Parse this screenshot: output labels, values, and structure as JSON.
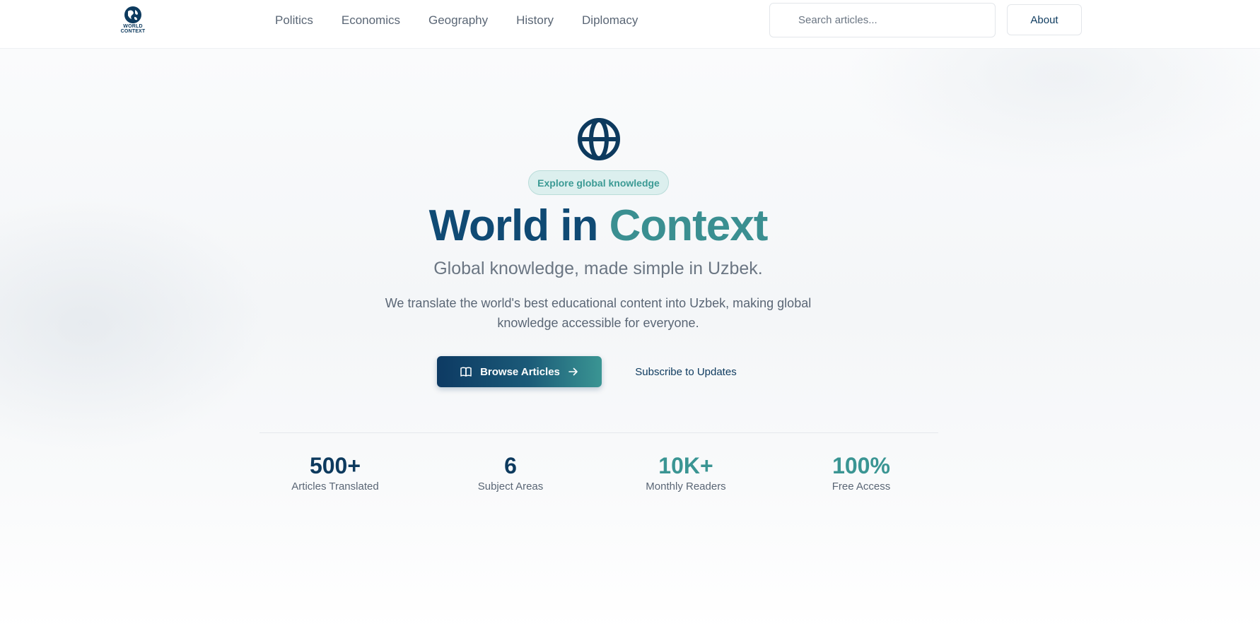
{
  "header": {
    "logo_text_line1": "WORLD",
    "logo_text_line2": "CONTEXT",
    "nav": [
      "Politics",
      "Economics",
      "Geography",
      "History",
      "Diplomacy"
    ],
    "search_placeholder": "Search articles...",
    "about_label": "About"
  },
  "hero": {
    "badge": "Explore global knowledge",
    "title_part1": "World in",
    "title_part2": "Context",
    "subtitle": "Global knowledge, made simple in Uzbek.",
    "description": "We translate the world's best educational content into Uzbek, making global knowledge accessible for everyone.",
    "browse_label": "Browse Articles",
    "subscribe_label": "Subscribe to Updates"
  },
  "stats": [
    {
      "value": "500+",
      "label": "Articles Translated",
      "color": "#0d3a5e"
    },
    {
      "value": "6",
      "label": "Subject Areas",
      "color": "#0d3a5e"
    },
    {
      "value": "10K+",
      "label": "Monthly Readers",
      "color": "#3a9593"
    },
    {
      "value": "100%",
      "label": "Free Access",
      "color": "#3a9593"
    }
  ],
  "colors": {
    "brand_navy": "#0d3a5e",
    "brand_teal": "#3a9593",
    "muted_text": "#5a6675"
  },
  "icons": {
    "logo": "globe-logo-icon",
    "hero": "globe-icon",
    "browse": "book-open-icon",
    "browse_arrow": "arrow-right-icon"
  }
}
